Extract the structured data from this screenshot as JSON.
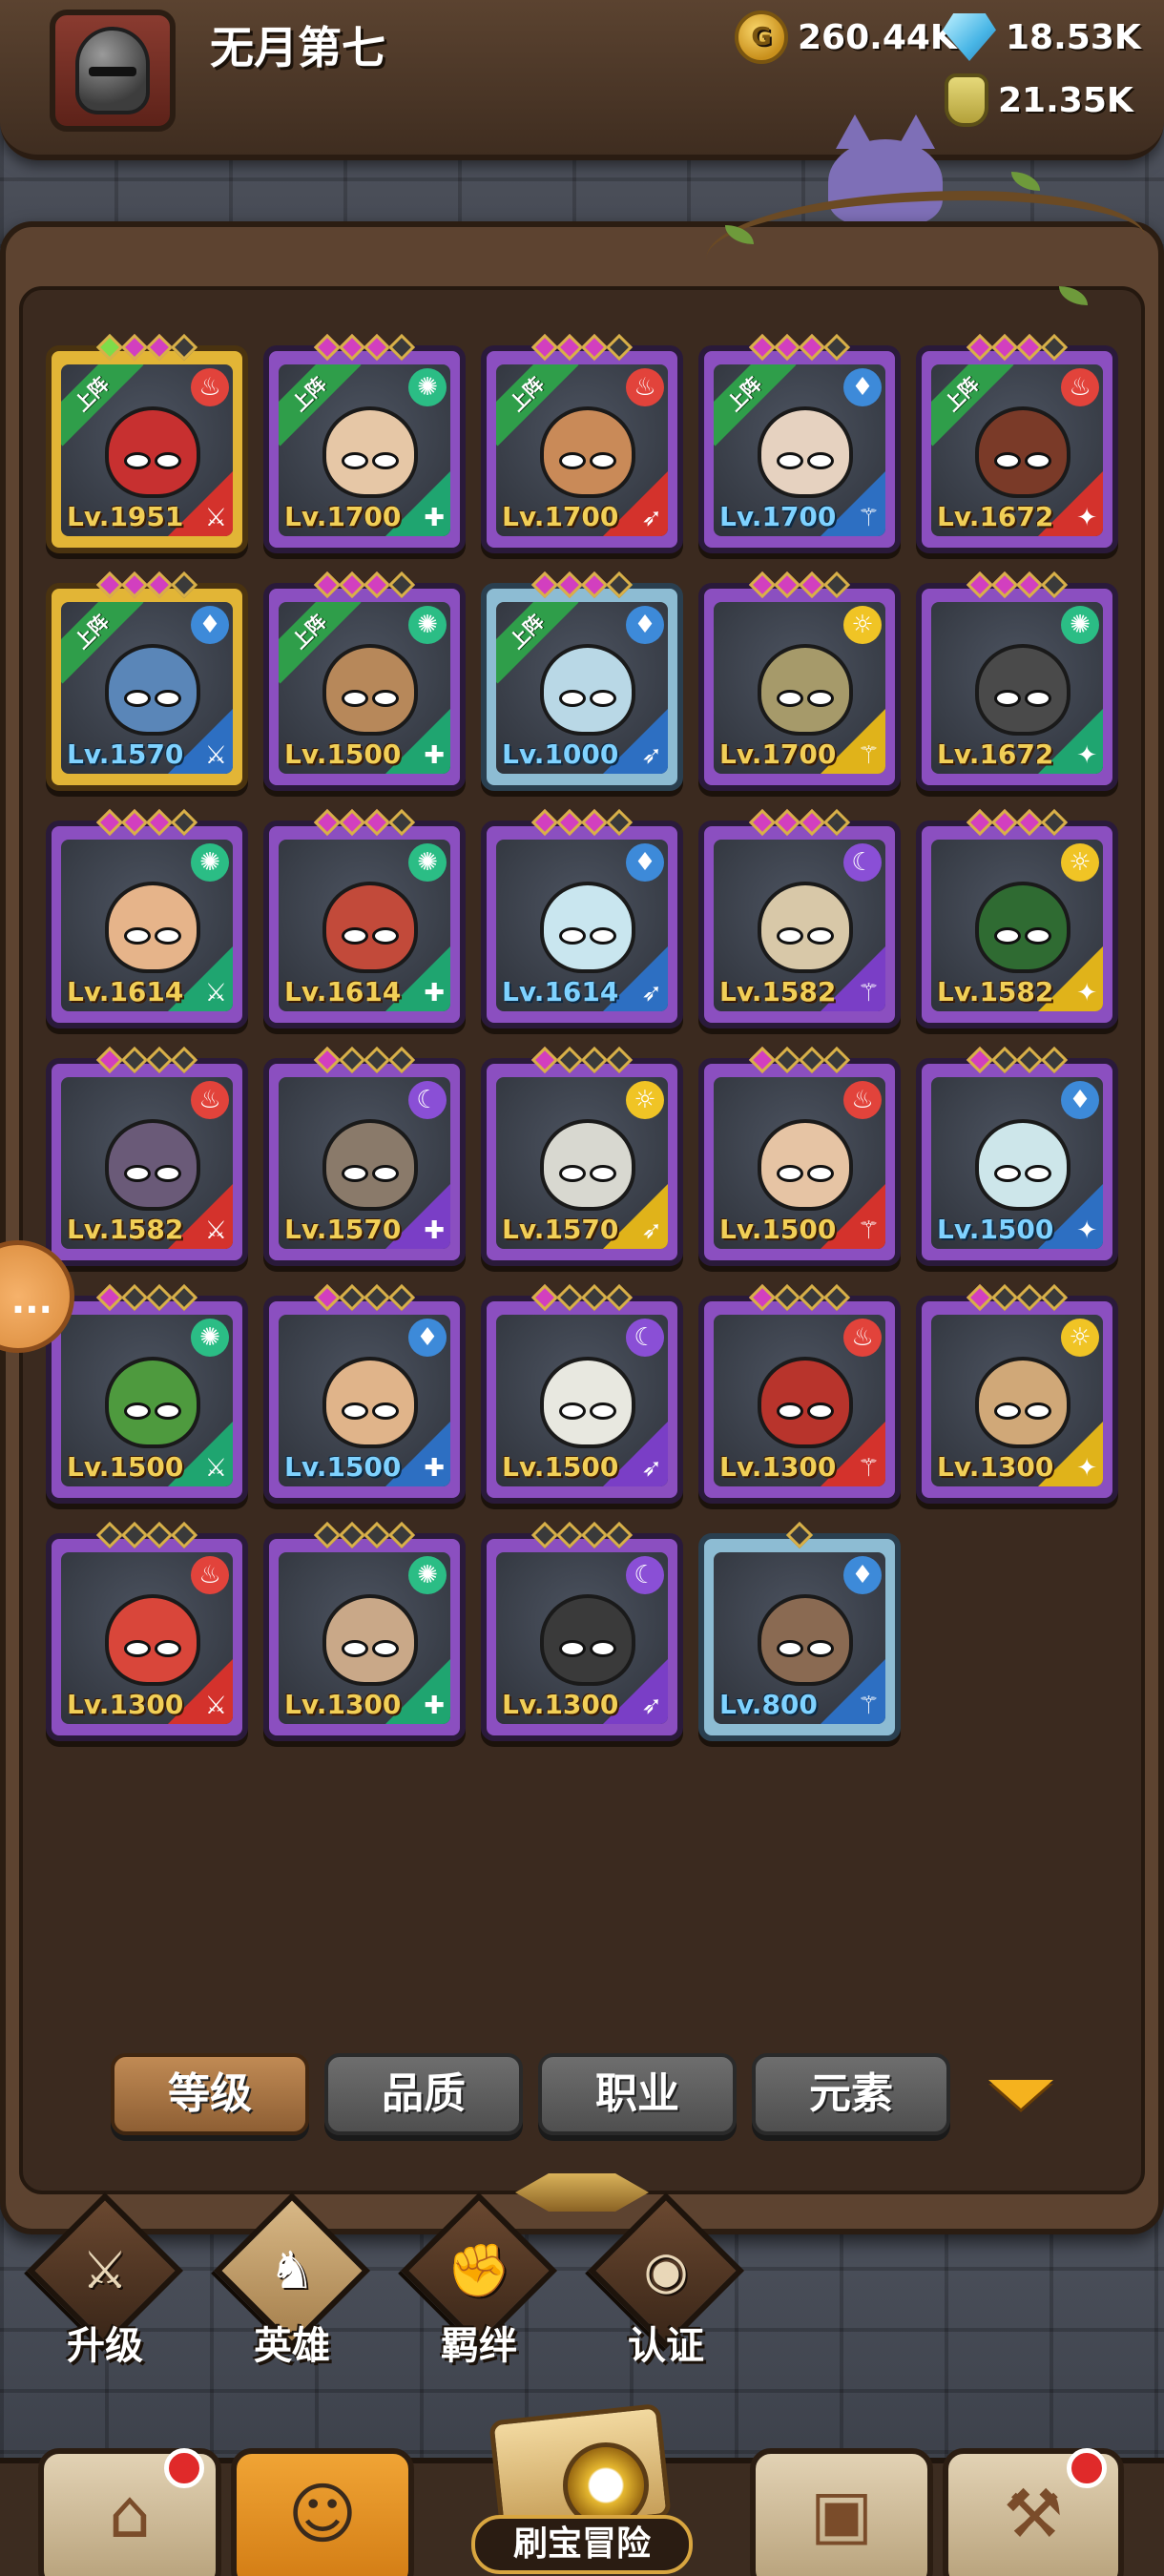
{
  "header": {
    "player_name": "无月第七",
    "gold": "260.44K",
    "gems": "18.53K",
    "potions": "21.35K",
    "gold_icon": "coin-icon",
    "gem_icon": "crystal-icon",
    "potion_icon": "potion-icon"
  },
  "team_badge": "上阵",
  "heroes": [
    {
      "level": "Lv.1951",
      "element": "fire",
      "frame": "gold",
      "in_team": true,
      "skin": "#c73030"
    },
    {
      "level": "Lv.1700",
      "element": "wind",
      "frame": "purple",
      "in_team": true,
      "skin": "#e6c7a6"
    },
    {
      "level": "Lv.1700",
      "element": "fire",
      "frame": "purple",
      "in_team": true,
      "skin": "#c98a58"
    },
    {
      "level": "Lv.1700",
      "element": "water",
      "frame": "purple",
      "in_team": true,
      "skin": "#e6d2c0"
    },
    {
      "level": "Lv.1672",
      "element": "fire",
      "frame": "purple",
      "in_team": true,
      "skin": "#7a3a28"
    },
    {
      "level": "Lv.1570",
      "element": "water",
      "frame": "gold",
      "in_team": true,
      "skin": "#5a86b8"
    },
    {
      "level": "Lv.1500",
      "element": "wind",
      "frame": "purple",
      "in_team": true,
      "skin": "#b7885a"
    },
    {
      "level": "Lv.1000",
      "element": "water",
      "frame": "blue",
      "in_team": true,
      "skin": "#b9d8e6"
    },
    {
      "level": "Lv.1700",
      "element": "light",
      "frame": "purple",
      "in_team": false,
      "skin": "#a69a6a"
    },
    {
      "level": "Lv.1672",
      "element": "wind",
      "frame": "purple",
      "in_team": false,
      "skin": "#4a4a4a"
    },
    {
      "level": "Lv.1614",
      "element": "wind",
      "frame": "purple",
      "in_team": false,
      "skin": "#e6b48a"
    },
    {
      "level": "Lv.1614",
      "element": "wind",
      "frame": "purple",
      "in_team": false,
      "skin": "#c24a3a"
    },
    {
      "level": "Lv.1614",
      "element": "water",
      "frame": "purple",
      "in_team": false,
      "skin": "#c9e6ef"
    },
    {
      "level": "Lv.1582",
      "element": "dark",
      "frame": "purple",
      "in_team": false,
      "skin": "#d8c8a8"
    },
    {
      "level": "Lv.1582",
      "element": "light",
      "frame": "purple",
      "in_team": false,
      "skin": "#2f6b32"
    },
    {
      "level": "Lv.1582",
      "element": "fire",
      "frame": "purple",
      "in_team": false,
      "skin": "#6a5a78"
    },
    {
      "level": "Lv.1570",
      "element": "dark",
      "frame": "purple",
      "in_team": false,
      "skin": "#8a7a6a"
    },
    {
      "level": "Lv.1570",
      "element": "light",
      "frame": "purple",
      "in_team": false,
      "skin": "#d8d8d0"
    },
    {
      "level": "Lv.1500",
      "element": "fire",
      "frame": "purple",
      "in_team": false,
      "skin": "#e6c4a4"
    },
    {
      "level": "Lv.1500",
      "element": "water",
      "frame": "purple",
      "in_team": false,
      "skin": "#cde6ea"
    },
    {
      "level": "Lv.1500",
      "element": "wind",
      "frame": "purple",
      "in_team": false,
      "skin": "#4e9a3e"
    },
    {
      "level": "Lv.1500",
      "element": "water",
      "frame": "purple",
      "in_team": false,
      "skin": "#e0b48a"
    },
    {
      "level": "Lv.1500",
      "element": "dark",
      "frame": "purple",
      "in_team": false,
      "skin": "#e8e8e0"
    },
    {
      "level": "Lv.1300",
      "element": "fire",
      "frame": "purple",
      "in_team": false,
      "skin": "#b8342c"
    },
    {
      "level": "Lv.1300",
      "element": "light",
      "frame": "purple",
      "in_team": false,
      "skin": "#d0a878"
    },
    {
      "level": "Lv.1300",
      "element": "fire",
      "frame": "purple",
      "in_team": false,
      "skin": "#d9463a"
    },
    {
      "level": "Lv.1300",
      "element": "wind",
      "frame": "purple",
      "in_team": false,
      "skin": "#c9a888"
    },
    {
      "level": "Lv.1300",
      "element": "dark",
      "frame": "purple",
      "in_team": false,
      "skin": "#3a3a3a"
    },
    {
      "level": "Lv.800",
      "element": "water",
      "frame": "blue",
      "in_team": false,
      "skin": "#8a6a52"
    }
  ],
  "element_glyphs": {
    "fire": "♨",
    "wind": "✺",
    "water": "♦",
    "light": "☼",
    "dark": "☾"
  },
  "role_glyphs": [
    "⚔",
    "✚",
    "➶",
    "⚚",
    "✦"
  ],
  "filters": {
    "level": "等级",
    "quality": "品质",
    "class": "职业",
    "element": "元素"
  },
  "subnav": {
    "upgrade": "升级",
    "heroes": "英雄",
    "bonds": "羁绊",
    "certify": "认证"
  },
  "bottom_nav": {
    "adventure": "刷宝冒险"
  },
  "side_bubble": "..."
}
